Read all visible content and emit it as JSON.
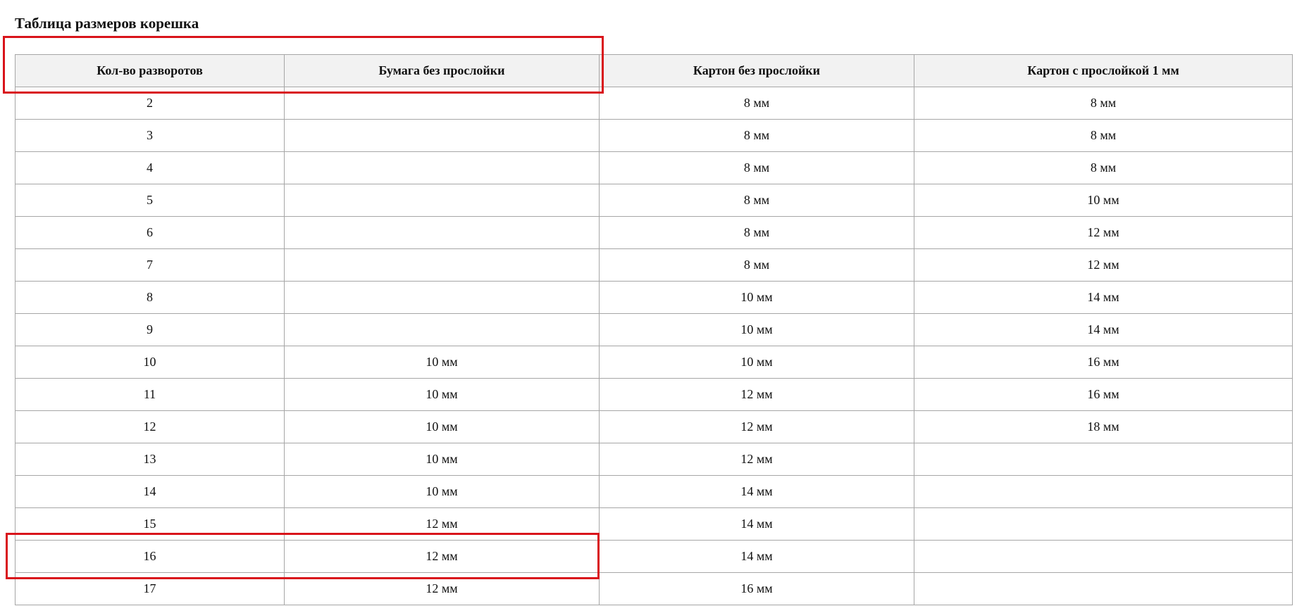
{
  "page": {
    "title": "Таблица размеров корешка"
  },
  "table": {
    "headers": [
      "Кол-во разворотов",
      "Бумага без прослойки",
      "Картон без прослойки",
      "Картон с прослойкой 1 мм"
    ],
    "rows": [
      [
        "2",
        "",
        "8 мм",
        "8 мм"
      ],
      [
        "3",
        "",
        "8 мм",
        "8 мм"
      ],
      [
        "4",
        "",
        "8 мм",
        "8 мм"
      ],
      [
        "5",
        "",
        "8 мм",
        "10 мм"
      ],
      [
        "6",
        "",
        "8 мм",
        "12 мм"
      ],
      [
        "7",
        "",
        "8 мм",
        "12 мм"
      ],
      [
        "8",
        "",
        "10 мм",
        "14 мм"
      ],
      [
        "9",
        "",
        "10 мм",
        "14 мм"
      ],
      [
        "10",
        "10 мм",
        "10 мм",
        "16 мм"
      ],
      [
        "11",
        "10 мм",
        "12 мм",
        "16 мм"
      ],
      [
        "12",
        "10 мм",
        "12 мм",
        "18 мм"
      ],
      [
        "13",
        "10 мм",
        "12 мм",
        ""
      ],
      [
        "14",
        "10 мм",
        "14 мм",
        ""
      ],
      [
        "15",
        "12 мм",
        "14 мм",
        ""
      ],
      [
        "16",
        "12 мм",
        "14 мм",
        ""
      ],
      [
        "17",
        "12 мм",
        "16 мм",
        ""
      ]
    ]
  },
  "annotations": {
    "highlight_color": "#d9141b"
  }
}
